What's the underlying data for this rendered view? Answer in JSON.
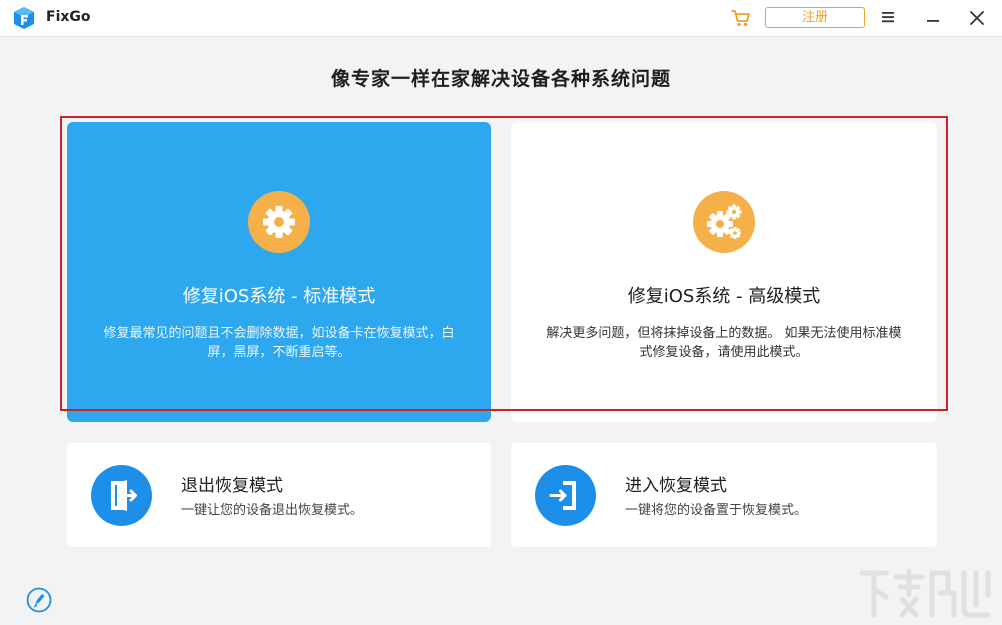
{
  "app": {
    "name": "FixGo",
    "logo_icon": "fixgo-logo-icon",
    "brand_color": "#1e8fe8"
  },
  "titlebar": {
    "register_label": "注册",
    "cart_icon": "cart-icon",
    "menu_icon": "menu-icon",
    "minimize_icon": "minimize-icon",
    "close_icon": "close-icon",
    "accent_color": "#f0a322"
  },
  "main": {
    "title": "像专家一样在家解决设备各种系统问题",
    "modes": [
      {
        "id": "standard",
        "title": "修复iOS系统 - 标准模式",
        "description": "修复最常见的问题且不会删除数据，如设备卡在恢复模式，白屏，黑屏，不断重启等。",
        "icon": "gear-icon",
        "selected": true
      },
      {
        "id": "advanced",
        "title": "修复iOS系统 - 高级模式",
        "description": "解决更多问题，但将抹掉设备上的数据。 如果无法使用标准模式修复设备，请使用此模式。",
        "icon": "gears-icon",
        "selected": false
      }
    ],
    "recovery": [
      {
        "id": "exit",
        "title": "退出恢复模式",
        "description": "一键让您的设备退出恢复模式。",
        "icon": "exit-door-icon"
      },
      {
        "id": "enter",
        "title": "进入恢复模式",
        "description": "一键将您的设备置于恢复模式。",
        "icon": "enter-door-icon"
      }
    ]
  },
  "footer": {
    "feedback_icon": "feedback-icon"
  },
  "colors": {
    "selected_card": "#2da7ee",
    "icon_orange": "#f5b04a",
    "icon_blue": "#1e8fe8",
    "highlight_red": "#d0212a"
  }
}
